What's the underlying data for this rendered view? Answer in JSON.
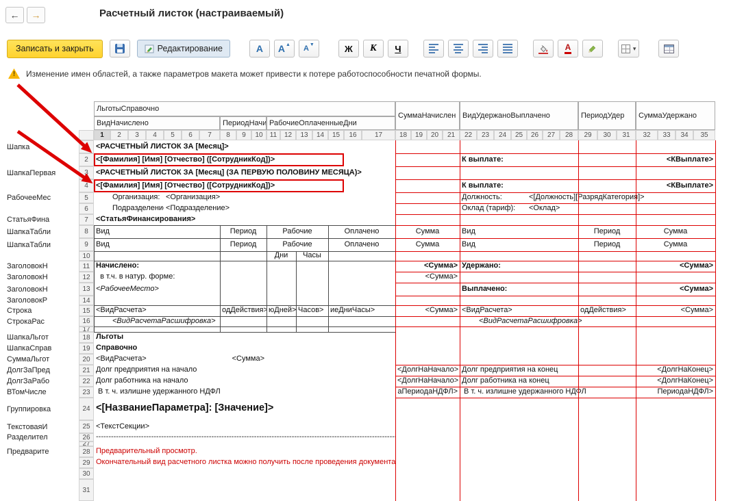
{
  "nav": {
    "back_glyph": "←",
    "forward_glyph": "→"
  },
  "header": {
    "title": "Расчетный листок (настраиваемый)"
  },
  "toolbar": {
    "save_close_label": "Записать и закрыть",
    "edit_label": "Редактирование",
    "font_label": "А",
    "font_increase_label": "А",
    "font_decrease_label": "А",
    "bold_label": "Ж",
    "italic_label": "К",
    "underline_label": "Ч",
    "font_color_label": "А"
  },
  "warning": {
    "text": "Изменение имен областей, а также параметров макета может привести к потере работоспособности печатной формы."
  },
  "colors": {
    "annotation_red": "#dd0000",
    "preview_red": "#cc0000",
    "grid_black": "#4a4a4a",
    "header_selected": "#dadada",
    "button_yellow": "#ffd22e",
    "icon_blue": "#2e6fae"
  },
  "grid": {
    "column_groups": [
      {
        "label": "ЛьготыСправочно",
        "from": 1,
        "to": 17,
        "tall": false
      },
      {
        "label": "СуммаНачислен",
        "from": 18,
        "to": 21,
        "tall": true
      },
      {
        "label": "ВидУдержаноВыплачено",
        "from": 22,
        "to": 28,
        "tall": true
      },
      {
        "label": "ПериодУдер",
        "from": 29,
        "to": 31,
        "tall": true
      },
      {
        "label": "СуммаУдержано",
        "from": 32,
        "to": 35,
        "tall": true
      }
    ],
    "column_subgroups": [
      {
        "label": "ВидНачислено",
        "from": 1,
        "to": 7
      },
      {
        "label": "ПериодНачи",
        "from": 8,
        "to": 10
      },
      {
        "label": "РабочиеОплаченныеДни",
        "from": 11,
        "to": 17
      }
    ],
    "column_numbers": [
      1,
      2,
      3,
      4,
      5,
      6,
      7,
      8,
      9,
      10,
      11,
      12,
      13,
      14,
      15,
      16,
      17,
      18,
      19,
      20,
      21,
      22,
      23,
      24,
      25,
      26,
      27,
      28,
      29,
      30,
      31,
      32,
      33,
      34,
      35
    ],
    "row_numbers": [
      1,
      2,
      3,
      4,
      5,
      6,
      7,
      8,
      9,
      10,
      11,
      12,
      13,
      14,
      15,
      16,
      17,
      18,
      19,
      20,
      21,
      22,
      23,
      24,
      25,
      26,
      27,
      28,
      29,
      30,
      31
    ],
    "row_areas": [
      {
        "row": 1,
        "label": "Шапка"
      },
      {
        "row": 3,
        "label": "ШапкаПервая"
      },
      {
        "row": 5,
        "label": "РабочееМес"
      },
      {
        "row": 7,
        "label": "СтатьяФина"
      },
      {
        "row": 8,
        "label": "ШапкаТабли"
      },
      {
        "row": 9,
        "label": "ШапкаТабли"
      },
      {
        "row": 11,
        "label": "ЗаголовокН"
      },
      {
        "row": 12,
        "label": "ЗаголовокН"
      },
      {
        "row": 13,
        "label": "ЗаголовокН"
      },
      {
        "row": 14,
        "label": "ЗаголовокР"
      },
      {
        "row": 15,
        "label": "Строка"
      },
      {
        "row": 16,
        "label": "СтрокаРас"
      },
      {
        "row": 18,
        "label": "ШапкаЛьгот"
      },
      {
        "row": 19,
        "label": "ШапкаСправ"
      },
      {
        "row": 20,
        "label": "СуммаЛьгот"
      },
      {
        "row": 21,
        "label": "ДолгЗаПред"
      },
      {
        "row": 22,
        "label": "ДолгЗаРабо"
      },
      {
        "row": 23,
        "label": "ВТомЧисле"
      },
      {
        "row": 24,
        "label": "Группировка"
      },
      {
        "row": 25,
        "label": "ТекстоваяИ"
      },
      {
        "row": 26,
        "label": "Разделител"
      },
      {
        "row": 28,
        "label": "Предварите"
      }
    ],
    "cells": [
      {
        "r": 1,
        "c1": 1,
        "c2": 17,
        "t": "<РАСЧЕТНЫЙ ЛИСТОК ЗА [Месяц]>",
        "s": "b"
      },
      {
        "r": 2,
        "c1": 1,
        "c2": 15,
        "t": "<[Фамилия] [Имя] [Отчество] ([СотрудникКод])>",
        "s": "b redbox"
      },
      {
        "r": 2,
        "c1": 22,
        "c2": 28,
        "t": "К выплате:",
        "s": "b"
      },
      {
        "r": 2,
        "c1": 32,
        "c2": 35,
        "t": "<КВыплате>",
        "s": "b r"
      },
      {
        "r": 3,
        "c1": 1,
        "c2": 17,
        "t": "<РАСЧЕТНЫЙ ЛИСТОК ЗА [Месяц] (ЗА ПЕРВУЮ ПОЛОВИНУ МЕСЯЦА)>",
        "s": "b"
      },
      {
        "r": 4,
        "c1": 1,
        "c2": 15,
        "t": "<[Фамилия] [Имя] [Отчество] ([СотрудникКод])>",
        "s": "b redbox"
      },
      {
        "r": 4,
        "c1": 22,
        "c2": 28,
        "t": "К выплате:",
        "s": "b"
      },
      {
        "r": 4,
        "c1": 32,
        "c2": 35,
        "t": "<КВыплате>",
        "s": "b r"
      },
      {
        "r": 5,
        "c1": 2,
        "c2": 4,
        "t": "Организация:",
        "s": ""
      },
      {
        "r": 5,
        "c1": 5,
        "c2": 17,
        "t": "<Организация>",
        "s": ""
      },
      {
        "r": 5,
        "c1": 22,
        "c2": 25,
        "t": "Должность:",
        "s": ""
      },
      {
        "r": 5,
        "c1": 26,
        "c2": 35,
        "t": "<[Должность][РазрядКатегория]>",
        "s": ""
      },
      {
        "r": 6,
        "c1": 2,
        "c2": 4,
        "t": "Подразделение:",
        "s": ""
      },
      {
        "r": 6,
        "c1": 5,
        "c2": 17,
        "t": "<Подразделение>",
        "s": ""
      },
      {
        "r": 6,
        "c1": 22,
        "c2": 25,
        "t": "Оклад (тариф):",
        "s": ""
      },
      {
        "r": 6,
        "c1": 26,
        "c2": 31,
        "t": "<Оклад>",
        "s": ""
      },
      {
        "r": 7,
        "c1": 1,
        "c2": 17,
        "t": "<СтатьяФинансирования>",
        "s": "b"
      },
      {
        "r": 8,
        "c1": 1,
        "c2": 7,
        "t": "Вид",
        "s": ""
      },
      {
        "r": 8,
        "c1": 8,
        "c2": 10,
        "t": "Период",
        "s": "c"
      },
      {
        "r": 8,
        "c1": 11,
        "c2": 14,
        "t": "Рабочие",
        "s": "c"
      },
      {
        "r": 8,
        "c1": 15,
        "c2": 17,
        "t": "Оплачено",
        "s": "c"
      },
      {
        "r": 8,
        "c1": 18,
        "c2": 21,
        "t": "Сумма",
        "s": "c"
      },
      {
        "r": 8,
        "c1": 22,
        "c2": 28,
        "t": "Вид",
        "s": ""
      },
      {
        "r": 8,
        "c1": 29,
        "c2": 31,
        "t": "Период",
        "s": "c"
      },
      {
        "r": 8,
        "c1": 32,
        "c2": 35,
        "t": "Сумма",
        "s": "c"
      },
      {
        "r": 9,
        "c1": 1,
        "c2": 7,
        "t": "Вид",
        "s": ""
      },
      {
        "r": 9,
        "c1": 8,
        "c2": 10,
        "t": "Период",
        "s": "c"
      },
      {
        "r": 9,
        "c1": 11,
        "c2": 14,
        "t": "Рабочие",
        "s": "c"
      },
      {
        "r": 9,
        "c1": 15,
        "c2": 17,
        "t": "Оплачено",
        "s": "c"
      },
      {
        "r": 9,
        "c1": 18,
        "c2": 21,
        "t": "Сумма",
        "s": "c"
      },
      {
        "r": 9,
        "c1": 22,
        "c2": 28,
        "t": "Вид",
        "s": ""
      },
      {
        "r": 9,
        "c1": 29,
        "c2": 31,
        "t": "Период",
        "s": "c"
      },
      {
        "r": 9,
        "c1": 32,
        "c2": 35,
        "t": "Сумма",
        "s": "c"
      },
      {
        "r": 10,
        "c1": 11,
        "c2": 12,
        "t": "Дни",
        "s": "c"
      },
      {
        "r": 10,
        "c1": 13,
        "c2": 14,
        "t": "Часы",
        "s": "c"
      },
      {
        "r": 11,
        "c1": 1,
        "c2": 7,
        "t": "Начислено:",
        "s": "b"
      },
      {
        "r": 11,
        "c1": 18,
        "c2": 21,
        "t": "<Сумма>",
        "s": "b r"
      },
      {
        "r": 11,
        "c1": 22,
        "c2": 28,
        "t": "Удержано:",
        "s": "b"
      },
      {
        "r": 11,
        "c1": 32,
        "c2": 35,
        "t": "<Сумма>",
        "s": "b r"
      },
      {
        "r": 12,
        "c1": 1,
        "c2": 10,
        "t": "  в т.ч. в натур. форме:",
        "s": ""
      },
      {
        "r": 12,
        "c1": 18,
        "c2": 21,
        "t": "<Сумма>",
        "s": "r"
      },
      {
        "r": 13,
        "c1": 1,
        "c2": 10,
        "t": "<РабочееМесто>",
        "s": "i"
      },
      {
        "r": 13,
        "c1": 22,
        "c2": 28,
        "t": "Выплачено:",
        "s": "b"
      },
      {
        "r": 13,
        "c1": 32,
        "c2": 35,
        "t": "<Сумма>",
        "s": "b r"
      },
      {
        "r": 15,
        "c1": 1,
        "c2": 7,
        "t": "<ВидРасчета>",
        "s": ""
      },
      {
        "r": 15,
        "c1": 8,
        "c2": 10,
        "t": "одДействия>",
        "s": ""
      },
      {
        "r": 15,
        "c1": 11,
        "c2": 12,
        "t": "юДней>",
        "s": ""
      },
      {
        "r": 15,
        "c1": 13,
        "c2": 14,
        "t": "Часов>",
        "s": ""
      },
      {
        "r": 15,
        "c1": 15,
        "c2": 17,
        "t": "иеДниЧасы>",
        "s": ""
      },
      {
        "r": 15,
        "c1": 18,
        "c2": 21,
        "t": "<Сумма>",
        "s": "r"
      },
      {
        "r": 15,
        "c1": 22,
        "c2": 28,
        "t": "<ВидРасчета>",
        "s": ""
      },
      {
        "r": 15,
        "c1": 29,
        "c2": 31,
        "t": "одДействия>",
        "s": ""
      },
      {
        "r": 15,
        "c1": 32,
        "c2": 35,
        "t": "<Сумма>",
        "s": "r"
      },
      {
        "r": 16,
        "c1": 2,
        "c2": 17,
        "t": "<ВидРасчетаРасшифровка>",
        "s": "i"
      },
      {
        "r": 16,
        "c1": 23,
        "c2": 35,
        "t": "<ВидРасчетаРасшифровка>",
        "s": "i"
      },
      {
        "r": 18,
        "c1": 1,
        "c2": 17,
        "t": "Льготы",
        "s": "b"
      },
      {
        "r": 19,
        "c1": 1,
        "c2": 17,
        "t": "Справочно",
        "s": "b"
      },
      {
        "r": 20,
        "c1": 1,
        "c2": 7,
        "t": "<ВидРасчета>",
        "s": ""
      },
      {
        "r": 20,
        "c1": 8,
        "c2": 10,
        "t": "<Сумма>",
        "s": "r"
      },
      {
        "r": 21,
        "c1": 1,
        "c2": 17,
        "t": "Долг предприятия на начало",
        "s": ""
      },
      {
        "r": 21,
        "c1": 18,
        "c2": 21,
        "t": "<ДолгНаНачало>",
        "s": "r"
      },
      {
        "r": 21,
        "c1": 22,
        "c2": 31,
        "t": "Долг предприятия на конец",
        "s": ""
      },
      {
        "r": 21,
        "c1": 32,
        "c2": 35,
        "t": "<ДолгНаКонец>",
        "s": "r"
      },
      {
        "r": 22,
        "c1": 1,
        "c2": 17,
        "t": "Долг работника на начало",
        "s": ""
      },
      {
        "r": 22,
        "c1": 18,
        "c2": 21,
        "t": "<ДолгНаНачало>",
        "s": "r"
      },
      {
        "r": 22,
        "c1": 22,
        "c2": 31,
        "t": "Долг работника на конец",
        "s": ""
      },
      {
        "r": 22,
        "c1": 32,
        "c2": 35,
        "t": "<ДолгНаКонец>",
        "s": "r"
      },
      {
        "r": 23,
        "c1": 1,
        "c2": 17,
        "t": " В т. ч. излишне удержанного НДФЛ",
        "s": ""
      },
      {
        "r": 23,
        "c1": 18,
        "c2": 21,
        "t": "аПериодаНДФЛ>",
        "s": "r"
      },
      {
        "r": 23,
        "c1": 22,
        "c2": 31,
        "t": " В т. ч. излишне удержанного НДФЛ",
        "s": ""
      },
      {
        "r": 23,
        "c1": 32,
        "c2": 35,
        "t": "ПериодаНДФЛ>",
        "s": "r"
      },
      {
        "r": 24,
        "c1": 1,
        "c2": 17,
        "t": "<[НазваниеПараметра]: [Значение]>",
        "s": "b big"
      },
      {
        "r": 25,
        "c1": 1,
        "c2": 17,
        "t": "<ТекстСекции>",
        "s": ""
      },
      {
        "r": 26,
        "c1": 1,
        "c2": 17,
        "t": "------------------------------------------------------------------------------------------------------------------------",
        "s": "dash"
      },
      {
        "r": 28,
        "c1": 1,
        "c2": 17,
        "t": "Предварительный просмотр.",
        "s": "red"
      },
      {
        "r": 29,
        "c1": 1,
        "c2": 17,
        "t": "Окончательный вид расчетного листка можно получить после проведения документа.",
        "s": "red"
      }
    ]
  }
}
